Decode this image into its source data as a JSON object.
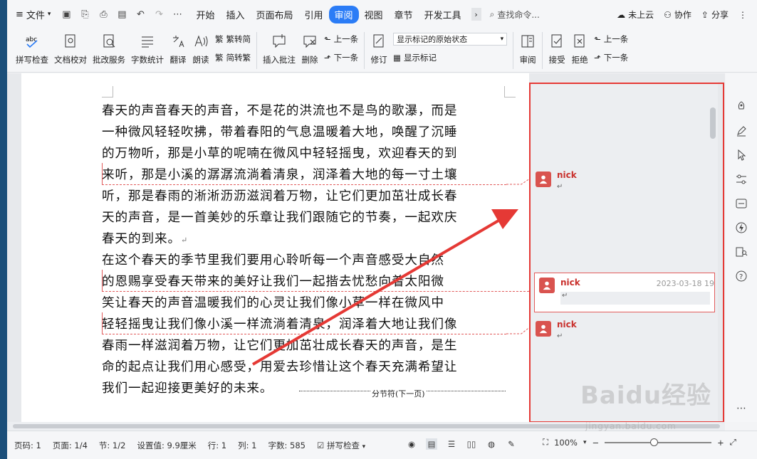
{
  "menubar": {
    "file_label": "文件",
    "tabs": [
      "开始",
      "插入",
      "页面布局",
      "引用",
      "审阅",
      "视图",
      "章节",
      "开发工具"
    ],
    "active_tab": "审阅",
    "search_placeholder": "查找命令...",
    "actions": [
      "未上云",
      "协作",
      "分享"
    ]
  },
  "ribbon": {
    "spell_check": "拼写检查",
    "doc_check": "文档校对",
    "review_service": "批改服务",
    "word_count": "字数统计",
    "translate": "翻译",
    "read_aloud": "朗读",
    "trad_to_simp": "繁转简",
    "simp_to_trad": "简转繁",
    "insert_comment": "插入批注",
    "delete": "删除",
    "prev": "上一条",
    "next": "下一条",
    "track_changes": "修订",
    "markup_mode": "显示标记的原始状态",
    "show_markup": "显示标记",
    "review": "审阅",
    "accept": "接受",
    "reject": "拒绝",
    "prev2": "上一条",
    "next2": "下一条"
  },
  "document": {
    "lines": [
      "春天的声音春天的声音，不是花的洪流也不是鸟的歌瀑，而是",
      "一种微风轻轻吹拂，带着春阳的气息温暖着大地，唤醒了沉睡",
      "的万物听，那是小草的呢喃在微风中轻轻摇曳，欢迎春天的到",
      "来听，那是小溪的潺潺流淌着清泉，润泽着大地的每一寸土壤",
      "听，那是春雨的淅淅沥沥滋润着万物，让它们更加茁壮成长春",
      "天的声音，是一首美妙的乐章让我们跟随它的节奏，一起欢庆",
      "春天的到来。",
      "在这个春天的季节里我们要用心聆听每一个声音感受大自然",
      "的恩赐享受春天带来的美好让我们一起揩去忧愁向着太阳微",
      "笑让春天的声音温暖我们的心灵让我们像小草一样在微风中",
      "轻轻摇曳让我们像小溪一样流淌着清泉，润泽着大地让我们像",
      "春雨一样滋润着万物，让它们更加茁壮成长春天的声音，是生",
      "命的起点让我们用心感受，用爱去珍惜让这个春天充满希望让",
      "我们一起迎接更美好的未来。"
    ],
    "section_break": "分节符(下一页)"
  },
  "comments": [
    {
      "author": "nick",
      "date": "",
      "body": "↵"
    },
    {
      "author": "nick",
      "date": "2023-03-18 19",
      "body": "↵"
    },
    {
      "author": "nick",
      "date": "",
      "body": "↵"
    }
  ],
  "statusbar": {
    "page_code": "页码: 1",
    "pages": "页面: 1/4",
    "section": "节: 1/2",
    "setting": "设置值: 9.9厘米",
    "row": "行: 1",
    "col": "列: 1",
    "word_count": "字数: 585",
    "spell_check": "拼写检查",
    "zoom": "100%"
  },
  "watermark": {
    "main": "Baidu经验",
    "sub": "jingyan.baidu.com"
  },
  "colors": {
    "accent": "#2b7cf6",
    "annotation_red": "#e53935",
    "comment_author": "#c9302c"
  }
}
